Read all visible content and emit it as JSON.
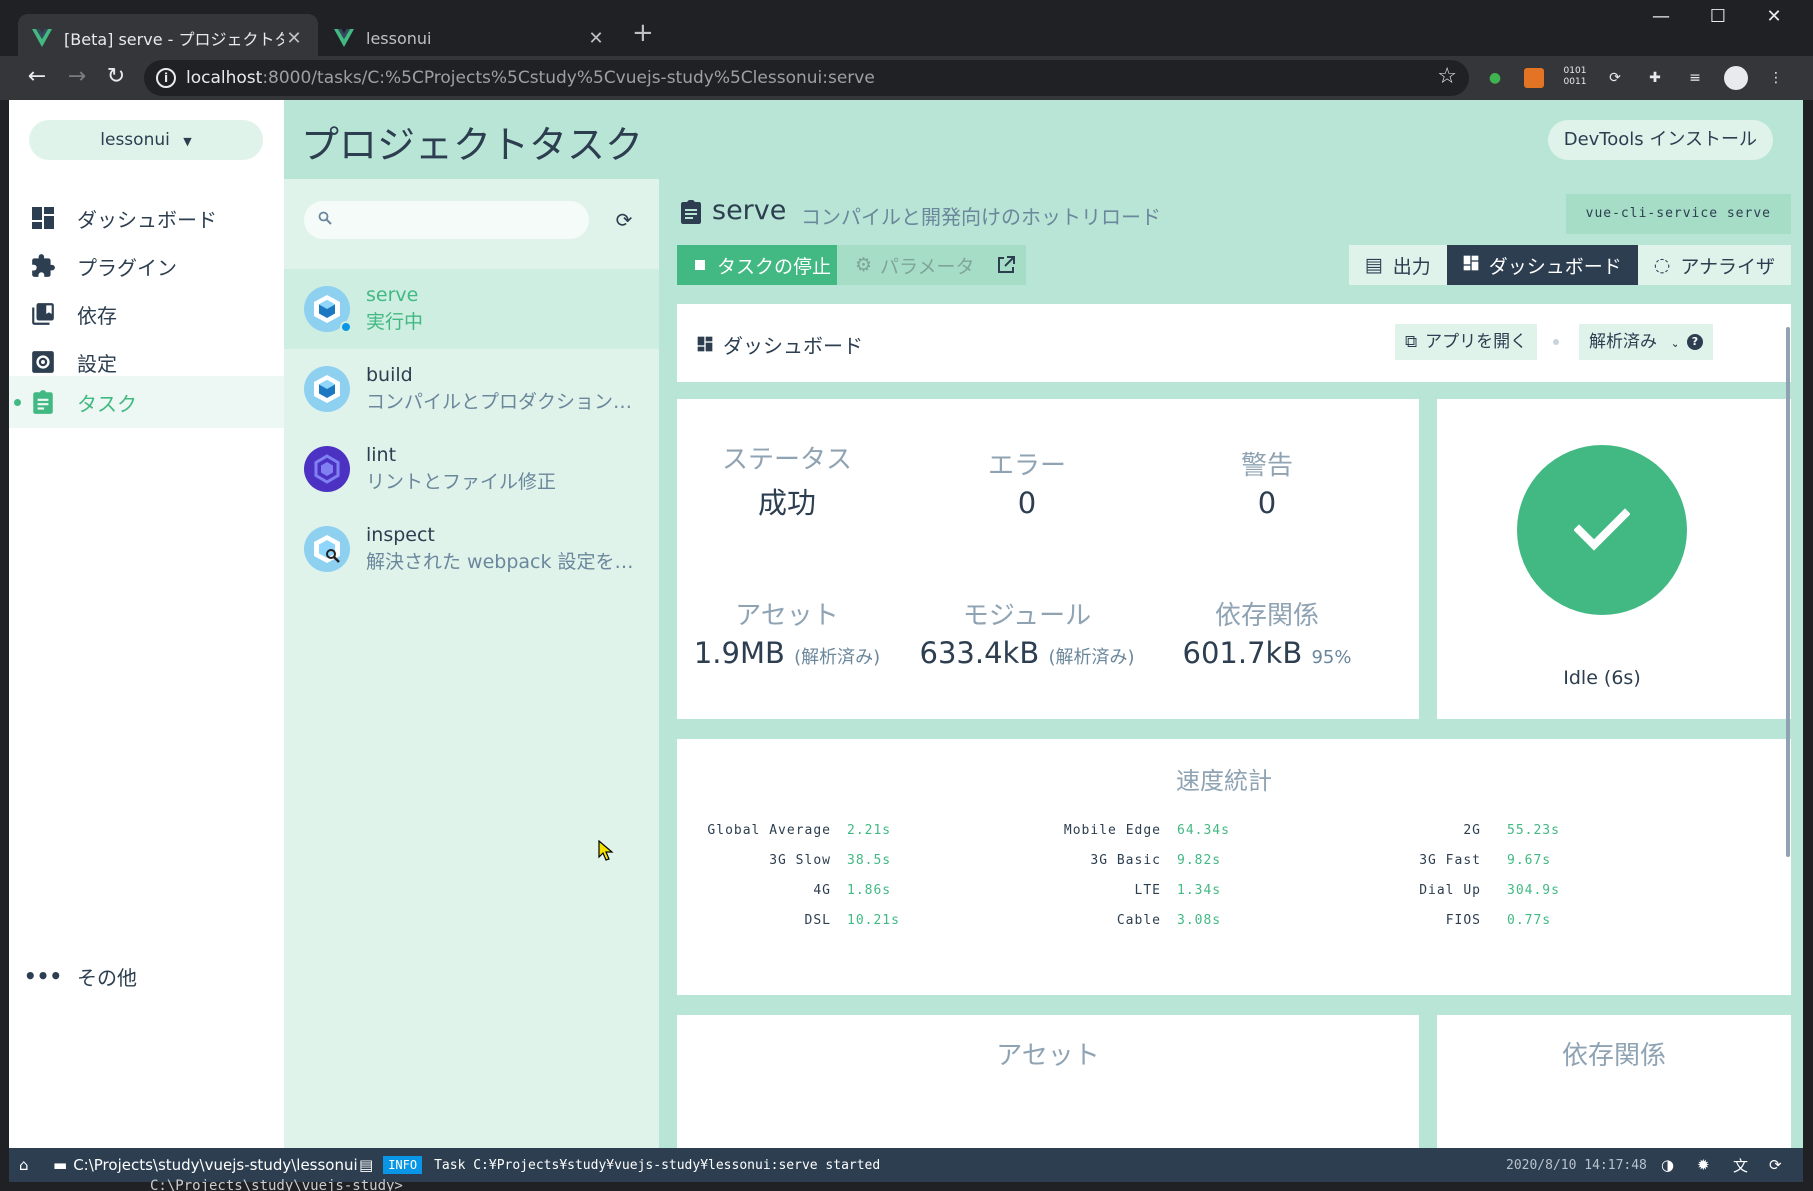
{
  "browser": {
    "tabs": [
      {
        "title": "[Beta] serve - プロジェクトタスク - Vue",
        "active": true
      },
      {
        "title": "lessonui",
        "active": false
      }
    ],
    "new_tab": "+",
    "window_controls": {
      "minimize": "—",
      "maximize": "☐",
      "close": "✕"
    },
    "url_host": "localhost",
    "url_rest": ":8000/tasks/C:%5CProjects%5Cstudy%5Cvuejs-study%5Clessonui:serve",
    "info_icon": "i",
    "extensions": [
      "evernote-icon",
      "extension-icon",
      "binary-icon",
      "sync-icon",
      "puzzle-icon",
      "media-icon",
      "avatar",
      "menu-icon"
    ]
  },
  "sidebar": {
    "project": "lessonui",
    "items": [
      {
        "label": "ダッシュボード",
        "icon": "dashboard-icon"
      },
      {
        "label": "プラグイン",
        "icon": "plugin-icon"
      },
      {
        "label": "依存",
        "icon": "dependency-icon"
      },
      {
        "label": "設定",
        "icon": "settings-icon"
      },
      {
        "label": "タスク",
        "icon": "task-icon",
        "selected": true
      }
    ],
    "more": "その他"
  },
  "header": {
    "title": "プロジェクトタスク",
    "devtools": "DevTools インストール"
  },
  "task_list": {
    "search_placeholder": "",
    "tasks": [
      {
        "name": "serve",
        "desc": "実行中",
        "icon": "webpack-icon",
        "active": true
      },
      {
        "name": "build",
        "desc": "コンパイルとプロダクション用の最小化",
        "icon": "webpack-icon"
      },
      {
        "name": "lint",
        "desc": "リントとファイル修正",
        "icon": "eslint-icon"
      },
      {
        "name": "inspect",
        "desc": "解決された webpack 設定を調査",
        "icon": "webpack-search-icon"
      }
    ]
  },
  "task": {
    "name": "serve",
    "desc": "コンパイルと開発向けのホットリロード",
    "command": "vue-cli-service serve",
    "stop_button": "タスクの停止",
    "param_button": "パラメータ",
    "views": [
      {
        "label": "出力",
        "icon": "output-icon"
      },
      {
        "label": "ダッシュボード",
        "icon": "dashboard-icon",
        "active": true
      },
      {
        "label": "アナライザ",
        "icon": "analyzer-icon"
      }
    ]
  },
  "dashboard": {
    "title": "ダッシュボード",
    "open_app": "アプリを開く",
    "parsed": "解析済み",
    "stats": {
      "status": {
        "label": "ステータス",
        "value": "成功"
      },
      "errors": {
        "label": "エラー",
        "value": "0"
      },
      "warnings": {
        "label": "警告",
        "value": "0"
      },
      "assets": {
        "label": "アセット",
        "value": "1.9MB",
        "note": "(解析済み)"
      },
      "modules": {
        "label": "モジュール",
        "value": "633.4kB",
        "note": "(解析済み)"
      },
      "deps": {
        "label": "依存関係",
        "value": "601.7kB",
        "note": "95%"
      }
    },
    "status_text": "Idle (6s)",
    "speed": {
      "title": "速度統計",
      "columns": [
        [
          {
            "label": "Global Average",
            "value": "2.21s"
          },
          {
            "label": "3G Slow",
            "value": "38.5s"
          },
          {
            "label": "4G",
            "value": "1.86s"
          },
          {
            "label": "DSL",
            "value": "10.21s"
          }
        ],
        [
          {
            "label": "Mobile Edge",
            "value": "64.34s"
          },
          {
            "label": "3G Basic",
            "value": "9.82s"
          },
          {
            "label": "LTE",
            "value": "1.34s"
          },
          {
            "label": "Cable",
            "value": "3.08s"
          }
        ],
        [
          {
            "label": "2G",
            "value": "55.23s"
          },
          {
            "label": "3G Fast",
            "value": "9.67s"
          },
          {
            "label": "Dial Up",
            "value": "304.9s"
          },
          {
            "label": "FIOS",
            "value": "0.77s"
          }
        ]
      ]
    },
    "assets_title": "アセット",
    "deps_title": "依存関係"
  },
  "statusbar": {
    "path": "C:\\Projects\\study\\vuejs-study\\lessonui",
    "level": "INFO",
    "message": "Task C:¥Projects¥study¥vuejs-study¥lessonui:serve started",
    "time": "2020/8/10 14:17:48"
  },
  "terminal": "C:\\Projects\\study\\vuejs-study>",
  "colors": {
    "accent": "#42b983",
    "dark": "#2c3e50",
    "bg": "#b9e5d6",
    "info": "#0a96e6"
  }
}
